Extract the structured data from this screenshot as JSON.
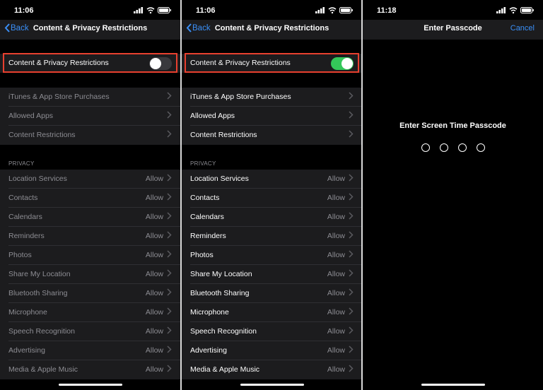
{
  "colors": {
    "accent": "#3a8ff7",
    "toggle_on": "#34c759",
    "toggle_off": "#39393d",
    "highlight": "#e8402f"
  },
  "screens": [
    {
      "time": "11:06",
      "back_label": "Back",
      "title": "Content & Privacy Restrictions",
      "toggle_label": "Content & Privacy Restrictions",
      "toggle_on": false,
      "group1": [
        "iTunes & App Store Purchases",
        "Allowed Apps",
        "Content Restrictions"
      ],
      "privacy_header": "PRIVACY",
      "privacy": [
        {
          "label": "Location Services",
          "value": "Allow"
        },
        {
          "label": "Contacts",
          "value": "Allow"
        },
        {
          "label": "Calendars",
          "value": "Allow"
        },
        {
          "label": "Reminders",
          "value": "Allow"
        },
        {
          "label": "Photos",
          "value": "Allow"
        },
        {
          "label": "Share My Location",
          "value": "Allow"
        },
        {
          "label": "Bluetooth Sharing",
          "value": "Allow"
        },
        {
          "label": "Microphone",
          "value": "Allow"
        },
        {
          "label": "Speech Recognition",
          "value": "Allow"
        },
        {
          "label": "Advertising",
          "value": "Allow"
        },
        {
          "label": "Media & Apple Music",
          "value": "Allow"
        }
      ]
    },
    {
      "time": "11:06",
      "back_label": "Back",
      "title": "Content & Privacy Restrictions",
      "toggle_label": "Content & Privacy Restrictions",
      "toggle_on": true,
      "group1": [
        "iTunes & App Store Purchases",
        "Allowed Apps",
        "Content Restrictions"
      ],
      "privacy_header": "PRIVACY",
      "privacy": [
        {
          "label": "Location Services",
          "value": "Allow"
        },
        {
          "label": "Contacts",
          "value": "Allow"
        },
        {
          "label": "Calendars",
          "value": "Allow"
        },
        {
          "label": "Reminders",
          "value": "Allow"
        },
        {
          "label": "Photos",
          "value": "Allow"
        },
        {
          "label": "Share My Location",
          "value": "Allow"
        },
        {
          "label": "Bluetooth Sharing",
          "value": "Allow"
        },
        {
          "label": "Microphone",
          "value": "Allow"
        },
        {
          "label": "Speech Recognition",
          "value": "Allow"
        },
        {
          "label": "Advertising",
          "value": "Allow"
        },
        {
          "label": "Media & Apple Music",
          "value": "Allow"
        }
      ]
    },
    {
      "time": "11:18",
      "title": "Enter Passcode",
      "cancel_label": "Cancel",
      "prompt": "Enter Screen Time Passcode",
      "digits": 4
    }
  ]
}
